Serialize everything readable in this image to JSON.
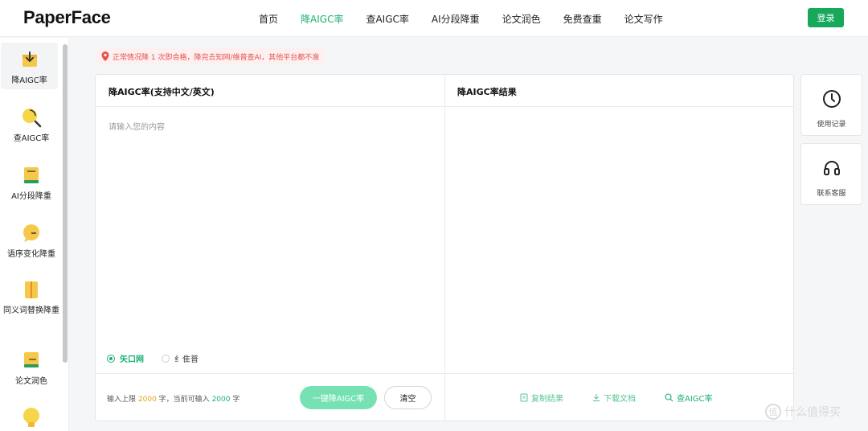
{
  "brand": {
    "logo": "PaperFace",
    "accent": "#1bb170",
    "login_bg": "#17a85b"
  },
  "nav": {
    "items": [
      "首页",
      "降AIGC率",
      "查AIGC率",
      "AI分段降重",
      "论文润色",
      "免费查重",
      "论文写作"
    ],
    "active_index": 1
  },
  "header": {
    "login_label": "登录"
  },
  "sidebar": {
    "items": [
      {
        "label": "降AIGC率",
        "icon": "download-icon"
      },
      {
        "label": "查AIGC率",
        "icon": "magnifier-icon"
      },
      {
        "label": "AI分段降重",
        "icon": "book-icon"
      },
      {
        "label": "语序变化降重",
        "icon": "chat-bubble-icon"
      },
      {
        "label": "同义词替换降重",
        "icon": "document-icon"
      },
      {
        "label": "论文润色",
        "icon": "book-pen-icon"
      },
      {
        "label": "",
        "icon": "lightbulb-icon"
      }
    ],
    "active_index": 0
  },
  "notice": {
    "text": "正常情况降 1 次即合格，降完去知网/维普查AI，其他平台都不准"
  },
  "editor": {
    "left_title": "降AIGC率(支持中文/英文)",
    "right_title": "降AIGC率结果",
    "placeholder": "请输入您的内容",
    "radios": [
      {
        "label": "矢口网",
        "checked": true
      },
      {
        "label": "纟隹普",
        "checked": false
      }
    ],
    "limit_prefix": "输入上限",
    "limit_value": "2000",
    "limit_mid": "字，当前可输入",
    "remaining_value": "2000",
    "limit_suffix": "字",
    "primary_label": "一键降AIGC率",
    "clear_label": "清空",
    "actions": [
      "复制结果",
      "下载文档",
      "查AIGC率"
    ]
  },
  "tools": [
    {
      "label": "使用记录",
      "icon": "clock-icon"
    },
    {
      "label": "联系客服",
      "icon": "headset-icon"
    }
  ],
  "watermark": {
    "text": "什么值得买",
    "badge": "值"
  }
}
